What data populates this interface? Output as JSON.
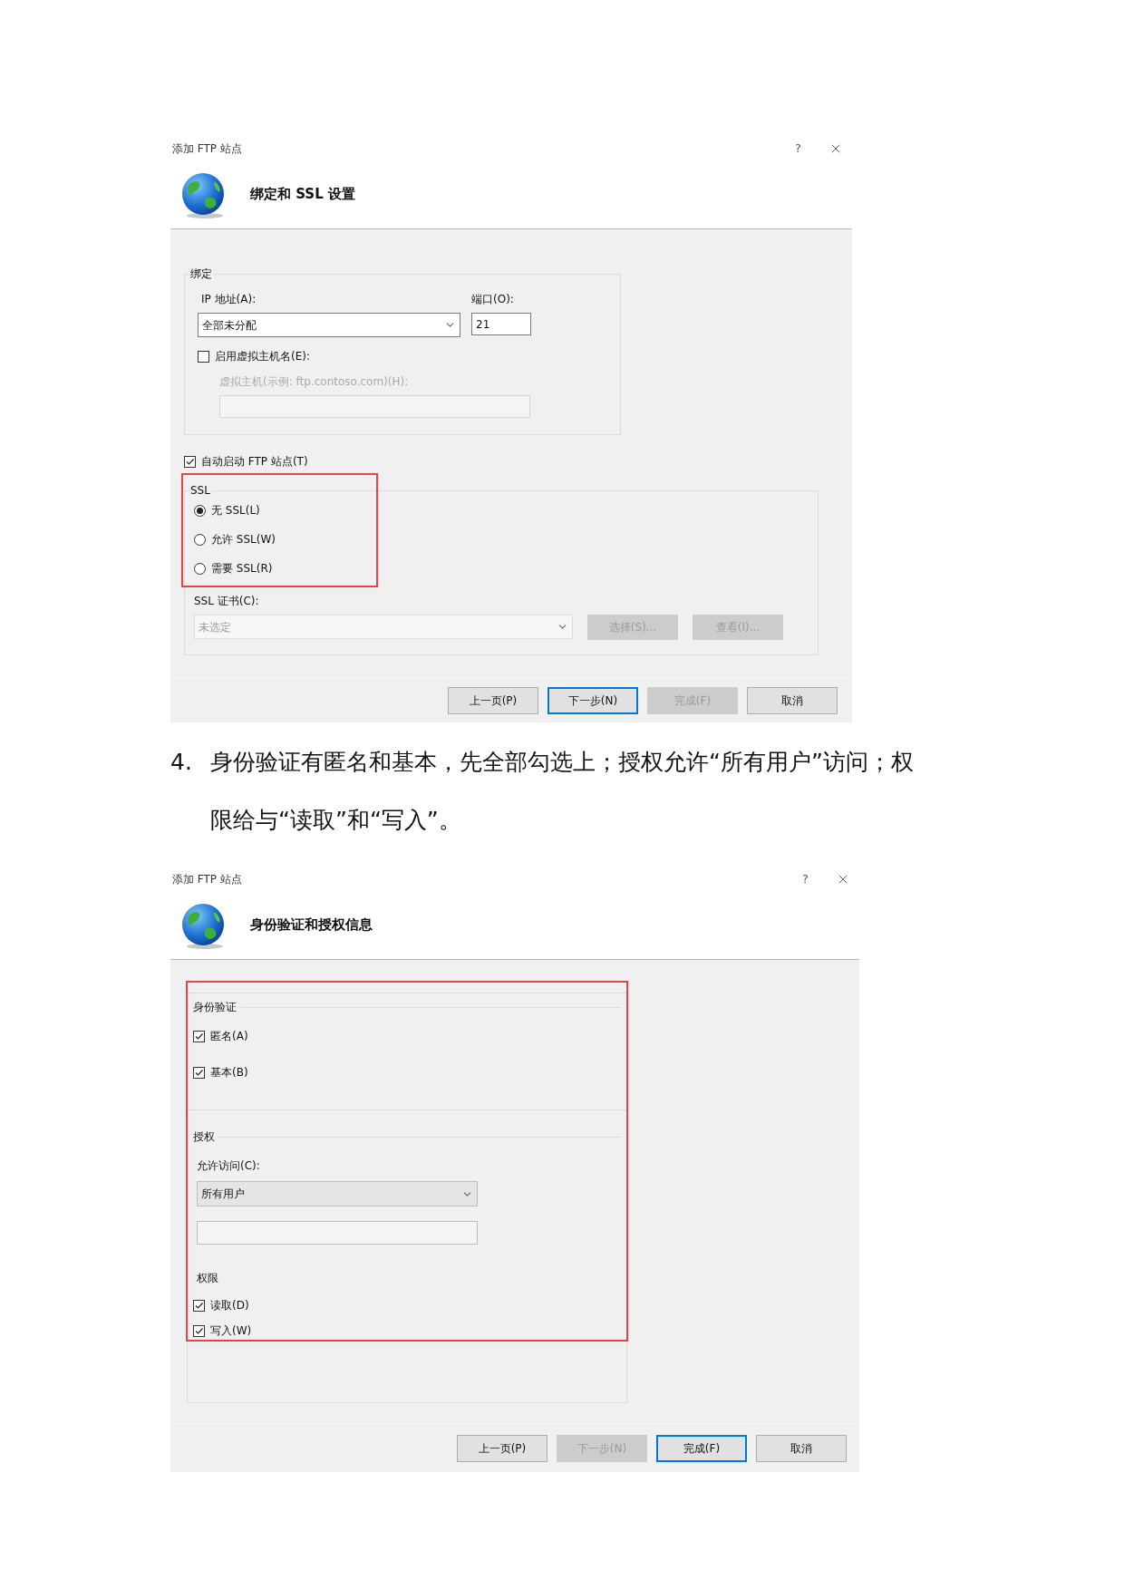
{
  "ssl_dialog": {
    "title": "添加 FTP 站点",
    "help": "?",
    "heading": "绑定和 SSL 设置",
    "binding": {
      "legend": "绑定",
      "ip_label": "IP 地址(A):",
      "ip_value": "全部未分配",
      "port_label": "端口(O):",
      "port_value": "21",
      "virtual_host": {
        "label": "启用虚拟主机名(E):",
        "checked": false
      },
      "host_label": "虚拟主机(示例: ftp.contoso.com)(H):"
    },
    "auto_start": {
      "label": "自动启动 FTP 站点(T)",
      "checked": true
    },
    "ssl": {
      "legend": "SSL",
      "highlighted": true,
      "options": [
        {
          "label": "无 SSL(L)",
          "selected": true
        },
        {
          "label": "允许 SSL(W)",
          "selected": false
        },
        {
          "label": "需要 SSL(R)",
          "selected": false
        }
      ],
      "cert_label": "SSL 证书(C):",
      "cert_value": "未选定",
      "buttons": [
        {
          "label": "选择(S)...",
          "disabled": true
        },
        {
          "label": "查看(I)...",
          "disabled": true
        }
      ]
    },
    "buttons": [
      {
        "label": "上一页(P)",
        "disabled": false,
        "default": false
      },
      {
        "label": "下一步(N)",
        "disabled": false,
        "default": true
      },
      {
        "label": "完成(F)",
        "disabled": true,
        "default": false
      },
      {
        "label": "取消",
        "disabled": false,
        "default": false
      }
    ]
  },
  "instruction": {
    "number": "4.",
    "lines": [
      "身份验证有匿名和基本，先全部勾选上；授权允许“所有用户”访问；权",
      "限给与“读取”和“写入”。"
    ]
  },
  "auth_dialog": {
    "title": "添加 FTP 站点",
    "help": "?",
    "heading": "身份验证和授权信息",
    "highlighted": true,
    "authentication": {
      "legend": "身份验证",
      "options": [
        {
          "label": "匿名(A)",
          "checked": true
        },
        {
          "label": "基本(B)",
          "checked": true
        }
      ]
    },
    "authorization": {
      "legend": "授权",
      "access_label": "允许访问(C):",
      "access_value": "所有用户"
    },
    "permissions": {
      "legend": "权限",
      "options": [
        {
          "label": "读取(D)",
          "checked": true
        },
        {
          "label": "写入(W)",
          "checked": true
        }
      ]
    },
    "buttons": [
      {
        "label": "上一页(P)",
        "disabled": false,
        "default": false
      },
      {
        "label": "下一步(N)",
        "disabled": true,
        "default": false
      },
      {
        "label": "完成(F)",
        "disabled": false,
        "default": true
      },
      {
        "label": "取消",
        "disabled": false,
        "default": false
      }
    ]
  }
}
